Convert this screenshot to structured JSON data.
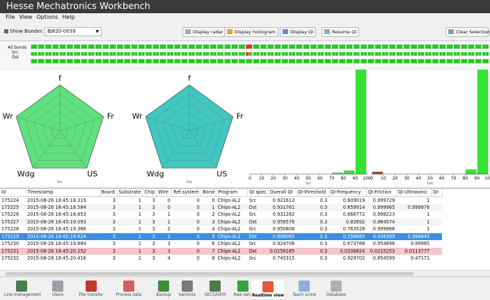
{
  "app": {
    "title": "Hesse Mechatronics Workbench"
  },
  "menu": [
    "File",
    "View",
    "Options",
    "Help"
  ],
  "toolbar": {
    "bonder_label": "Show Bonder:",
    "bonder_value": "BJ820-0039",
    "display_radar": "Display radar",
    "display_histogram": "Display histogram",
    "display_qi": "Display QI",
    "resume_qi": "Resume QI",
    "clear_selection": "Clear Selection"
  },
  "bonds": {
    "labels": [
      "All bonds",
      "Src",
      "Dst"
    ],
    "count": 64,
    "highlight_index": 30,
    "color_ok": "#2ec52e",
    "color_bad": "#e03030"
  },
  "radar": {
    "charts": [
      {
        "name": "Src",
        "fill": "#5fe07e"
      },
      {
        "name": "Dst",
        "fill": "#3fc7c0"
      }
    ],
    "axes": [
      "f",
      "Fr",
      "US",
      "Wdg",
      "Wr"
    ]
  },
  "histogram": {
    "charts": [
      {
        "name": "Src",
        "values": [
          0,
          0,
          0,
          0,
          0,
          0,
          0,
          0.01,
          0.03,
          1.0
        ]
      },
      {
        "name": "Dst",
        "values": [
          0.02,
          0,
          0,
          0,
          0,
          0,
          0,
          0,
          0.04,
          1.0
        ]
      }
    ],
    "ticks": [
      "0",
      "10",
      "20",
      "30",
      "40",
      "50",
      "60",
      "70",
      "80",
      "90",
      "100"
    ],
    "bar_color": "#33e533",
    "small_bar_color": "#c0392b"
  },
  "table": {
    "columns": [
      "Id",
      "Timestamp",
      "Board",
      "Substrate",
      "Chip",
      "Wire",
      "Ref system",
      "Bond",
      "Program",
      "QI spec",
      "Overall QI",
      "QI-threshold",
      "QI-Frequency",
      "QI-Friction",
      "QI-Ultrasonic",
      "QI-"
    ],
    "rows": [
      {
        "cells": [
          "175224",
          "2015-08-26 18:45:18.319",
          "3",
          "1",
          "3",
          "0",
          "0",
          "0",
          "Chips-AL2",
          "Src",
          "0.921613",
          "0.3",
          "0.609019",
          "0.999729",
          "1",
          ""
        ],
        "state": ""
      },
      {
        "cells": [
          "175225",
          "2015-08-26 18:45:18.584",
          "3",
          "1",
          "3",
          "0",
          "0",
          "1",
          "Chips-AL2",
          "Dst",
          "0.931761",
          "0.3",
          "0.659914",
          "0.999965",
          "0.999976",
          ""
        ],
        "state": "alt"
      },
      {
        "cells": [
          "175226",
          "2015-08-26 18:45:18.853",
          "3",
          "1",
          "3",
          "1",
          "0",
          "2",
          "Chips-AL2",
          "Src",
          "0.931282",
          "0.3",
          "0.668772",
          "0.998223",
          "1",
          ""
        ],
        "state": ""
      },
      {
        "cells": [
          "175227",
          "2015-08-26 18:45:19.093",
          "3",
          "1",
          "3",
          "1",
          "0",
          "3",
          "Chips-AL2",
          "Dst",
          "0.956576",
          "0.3",
          "0.82692",
          "0.964574",
          "1",
          ""
        ],
        "state": "alt"
      },
      {
        "cells": [
          "175228",
          "2015-08-26 18:45:19.366",
          "3",
          "1",
          "3",
          "2",
          "0",
          "4",
          "Chips-AL2",
          "Src",
          "0.950808",
          "0.3",
          "0.763528",
          "0.999966",
          "1",
          ""
        ],
        "state": ""
      },
      {
        "cells": [
          "175229",
          "2015-08-26 18:45:19.624",
          "3",
          "1",
          "3",
          "2",
          "0",
          "5",
          "Chips-AL2",
          "Dst",
          "0.896065",
          "0.3",
          "0.556685",
          "0.936399",
          "0.988845",
          ""
        ],
        "state": "sel"
      },
      {
        "cells": [
          "175230",
          "2015-08-26 18:45:19.884",
          "3",
          "1",
          "3",
          "3",
          "0",
          "6",
          "Chips-AL2",
          "Src",
          "0.924706",
          "0.3",
          "0.673766",
          "0.954896",
          "0.99985",
          ""
        ],
        "state": ""
      },
      {
        "cells": [
          "175231",
          "2015-08-26 18:45:20.152",
          "3",
          "1",
          "3",
          "3",
          "0",
          "7",
          "Chips-AL2",
          "Dst",
          "0.0156185",
          "0.3",
          "0.0336824",
          "0.0215253",
          "0.0113777",
          ""
        ],
        "state": "err"
      },
      {
        "cells": [
          "175232",
          "2015-08-26 18:45:20.416",
          "3",
          "1",
          "3",
          "4",
          "0",
          "8",
          "Chips-AL2",
          "Src",
          "0.745315",
          "0.3",
          "0.929702",
          "0.854599",
          "0.47171",
          ""
        ],
        "state": ""
      }
    ]
  },
  "bottom_nav": [
    {
      "label": "Line management",
      "icon": "line-management-icon",
      "color": "#4a7c4e"
    },
    {
      "label": "Users",
      "icon": "users-icon",
      "color": "#9aa0a6"
    },
    {
      "label": "File transfer",
      "icon": "file-transfer-icon",
      "color": "#c0392b"
    },
    {
      "label": "Process data",
      "icon": "process-data-icon",
      "color": "#d35f5f"
    },
    {
      "label": "Backup",
      "icon": "backup-icon",
      "color": "#3e8e3e"
    },
    {
      "label": "Services",
      "icon": "services-icon",
      "color": "#7a7a7a"
    },
    {
      "label": "SECS/GEM",
      "icon": "secs-gem-icon",
      "color": "#4c7a4c"
    },
    {
      "label": "Raw data",
      "icon": "raw-data-icon",
      "color": "#3aa03a"
    },
    {
      "label": "Realtime view",
      "icon": "realtime-view-icon",
      "color": "#e05a3a"
    },
    {
      "label": "Teach score",
      "icon": "teach-score-icon",
      "color": "#8fb0d8"
    },
    {
      "label": "Database",
      "icon": "database-icon",
      "color": "#b0b0b0"
    }
  ],
  "bottom_nav_active": 8
}
